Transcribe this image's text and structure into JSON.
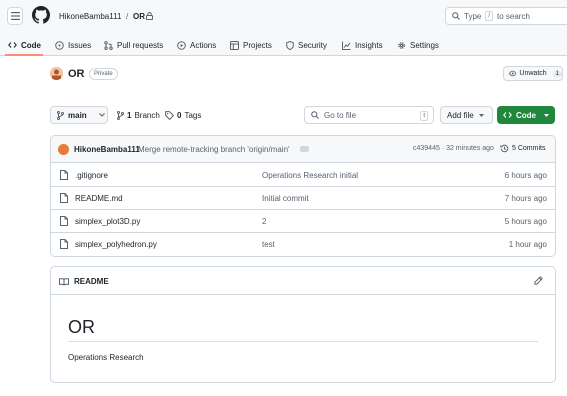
{
  "header": {
    "owner": "HikoneBamba111",
    "separator": "/",
    "repo": "OR",
    "search_placeholder_prefix": "Type",
    "search_key": "/",
    "search_placeholder_suffix": "to search"
  },
  "tabs": [
    {
      "label": "Code",
      "icon": "code-icon"
    },
    {
      "label": "Issues",
      "icon": "issue-icon"
    },
    {
      "label": "Pull requests",
      "icon": "pull-request-icon"
    },
    {
      "label": "Actions",
      "icon": "play-icon"
    },
    {
      "label": "Projects",
      "icon": "table-icon"
    },
    {
      "label": "Security",
      "icon": "shield-icon"
    },
    {
      "label": "Insights",
      "icon": "graph-icon"
    },
    {
      "label": "Settings",
      "icon": "gear-icon"
    }
  ],
  "repo": {
    "name": "OR",
    "visibility": "Private",
    "unwatch_label": "Unwatch",
    "watch_count": "1"
  },
  "toolbar": {
    "branch": "main",
    "branches_count": "1",
    "branches_label": "Branch",
    "tags_count": "0",
    "tags_label": "Tags",
    "goto_placeholder": "Go to file",
    "goto_key": "t",
    "add_file": "Add file",
    "code_button": "Code"
  },
  "commit": {
    "user": "HikoneBamba111",
    "message": "Merge remote-tracking branch 'origin/main'",
    "hash_time": "c439445 · 32 minutes ago",
    "commits": "5 Commits"
  },
  "files": [
    {
      "name": ".gitignore",
      "message": "Operations Research initial",
      "age": "6 hours ago"
    },
    {
      "name": "README.md",
      "message": "Initial commit",
      "age": "7 hours ago"
    },
    {
      "name": "simplex_plot3D.py",
      "message": "2",
      "age": "5 hours ago"
    },
    {
      "name": "simplex_polyhedron.py",
      "message": "test",
      "age": "1 hour ago"
    }
  ],
  "readme": {
    "label": "README",
    "heading": "OR",
    "body": "Operations Research"
  },
  "colors": {
    "accent_underline": "#fd8c73",
    "code_button": "#1f883d",
    "muted_text": "#59636e",
    "border": "#d0d7de"
  }
}
